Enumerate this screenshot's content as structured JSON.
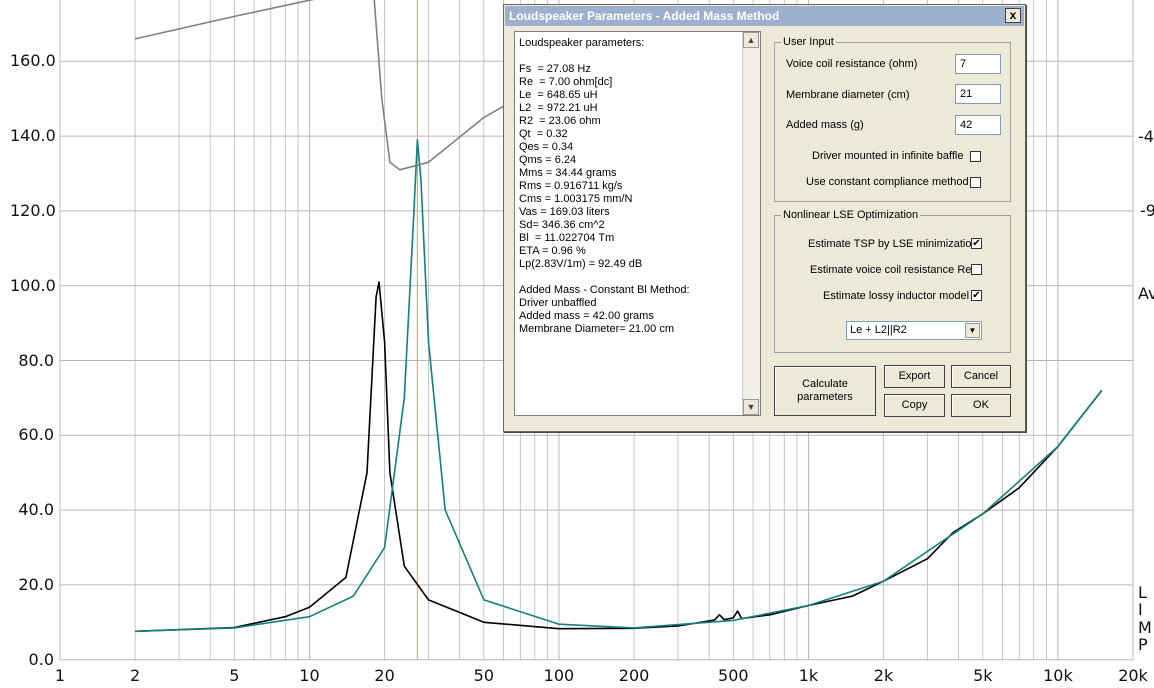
{
  "plot": {
    "y_ticks": [
      "160.0",
      "140.0",
      "120.0",
      "100.0",
      "80.0",
      "60.0",
      "40.0",
      "20.0",
      "0.0"
    ],
    "x_ticks": [
      "1",
      "2",
      "5",
      "10",
      "20",
      "50",
      "100",
      "200",
      "500",
      "1k",
      "2k",
      "5k",
      "10k",
      "20k"
    ],
    "right_labels": [
      "-4",
      "-9",
      "Av",
      "L",
      "I",
      "M",
      "P"
    ],
    "colors": {
      "curve_unloaded": "#000000",
      "curve_added_mass": "#138080",
      "curve_phase": "#808080",
      "marker": "#e8b820",
      "grid": "#b8b8b8"
    }
  },
  "chart_data": {
    "type": "line",
    "xscale": "log",
    "xlim": [
      1,
      20000
    ],
    "ylim": [
      0,
      170
    ],
    "grid": true,
    "series": [
      {
        "color": "#000000",
        "points": [
          [
            2,
            7.6
          ],
          [
            5,
            8.6
          ],
          [
            8,
            11.5
          ],
          [
            10,
            14
          ],
          [
            14,
            22
          ],
          [
            17,
            50
          ],
          [
            18.5,
            97
          ],
          [
            19,
            101
          ],
          [
            20,
            85
          ],
          [
            21,
            50
          ],
          [
            24,
            25
          ],
          [
            30,
            16
          ],
          [
            50,
            10
          ],
          [
            100,
            8.3
          ],
          [
            200,
            8.4
          ],
          [
            300,
            9
          ],
          [
            420,
            10.6
          ],
          [
            440,
            12
          ],
          [
            460,
            10.7
          ],
          [
            500,
            11.2
          ],
          [
            520,
            13
          ],
          [
            540,
            11
          ],
          [
            700,
            12
          ],
          [
            1000,
            14.5
          ],
          [
            1500,
            17
          ],
          [
            2000,
            21
          ],
          [
            3000,
            27
          ],
          [
            3800,
            34
          ],
          [
            5000,
            39
          ],
          [
            7000,
            46
          ],
          [
            10000,
            57
          ],
          [
            15000,
            72
          ]
        ]
      },
      {
        "color": "#138080",
        "points": [
          [
            2,
            7.6
          ],
          [
            5,
            8.5
          ],
          [
            10,
            11.5
          ],
          [
            15,
            17
          ],
          [
            20,
            30
          ],
          [
            24,
            70
          ],
          [
            26,
            115
          ],
          [
            27.08,
            139
          ],
          [
            28,
            128
          ],
          [
            30,
            85
          ],
          [
            35,
            40
          ],
          [
            50,
            16
          ],
          [
            100,
            9.5
          ],
          [
            200,
            8.5
          ],
          [
            500,
            10.5
          ],
          [
            1000,
            14.5
          ],
          [
            2000,
            21
          ],
          [
            5000,
            39
          ],
          [
            10000,
            57
          ],
          [
            15000,
            72
          ]
        ]
      },
      {
        "color": "#808080",
        "points": [
          [
            2,
            166
          ],
          [
            5,
            172
          ],
          [
            18,
            180
          ],
          [
            19.5,
            150
          ],
          [
            21,
            133
          ],
          [
            23,
            131
          ],
          [
            30,
            133
          ],
          [
            50,
            145
          ],
          [
            60,
            148
          ]
        ]
      }
    ],
    "marker_x": 27.08
  },
  "dialog": {
    "title": "Loudspeaker Parameters - Added Mass Method",
    "close_label": "x",
    "params_text": "Loudspeaker parameters:\n\nFs  = 27.08 Hz\nRe  = 7.00 ohm[dc]\nLe  = 648.65 uH\nL2  = 972.21 uH\nR2  = 23.06 ohm\nQt  = 0.32\nQes = 0.34\nQms = 6.24\nMms = 34.44 grams\nRms = 0.916711 kg/s\nCms = 1.003175 mm/N\nVas = 169.03 liters\nSd= 346.36 cm^2\nBl  = 11.022704 Tm\nETA = 0.96 %\nLp(2.83V/1m) = 92.49 dB\n\nAdded Mass - Constant Bl Method:\nDriver unbaffled\nAdded mass = 42.00 grams\nMembrane Diameter= 21.00 cm",
    "user_input": {
      "legend": "User Input",
      "voice_coil_label": "Voice coil resistance (ohm)",
      "voice_coil_value": "7",
      "membrane_label": "Membrane diameter (cm)",
      "membrane_value": "21",
      "added_mass_label": "Added mass (g)",
      "added_mass_value": "42",
      "infinite_baffle_label": "Driver mounted in infinite baffle",
      "infinite_baffle_checked": "",
      "constant_compliance_label": "Use constant compliance method",
      "constant_compliance_checked": ""
    },
    "lse": {
      "legend": "Nonlinear LSE Optimization",
      "estimate_tsp_label": "Estimate TSP by LSE minimization",
      "estimate_tsp_checked": "✔",
      "estimate_re_label": "Estimate voice coil resistance Re",
      "estimate_re_checked": "",
      "lossy_inductor_label": "Estimate lossy inductor model",
      "lossy_inductor_checked": "✔",
      "model_value": "Le + L2||R2"
    },
    "buttons": {
      "calculate": "Calculate parameters",
      "export": "Export",
      "cancel": "Cancel",
      "copy": "Copy",
      "ok": "OK"
    }
  }
}
